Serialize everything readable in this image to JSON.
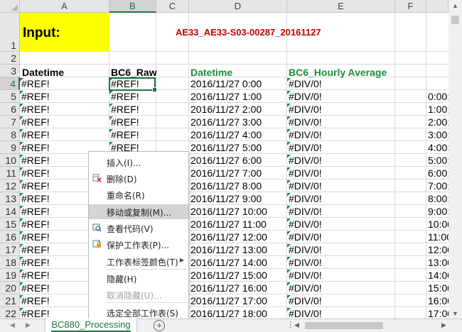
{
  "columns": [
    "A",
    "B",
    "C",
    "D",
    "E",
    "F"
  ],
  "rows": [
    "1",
    "2",
    "3",
    "4",
    "5",
    "6",
    "7",
    "8",
    "9",
    "10",
    "11",
    "12",
    "13",
    "14",
    "15",
    "16",
    "17",
    "18",
    "19",
    "20",
    "21",
    "22"
  ],
  "top": {
    "input_label": "Input:",
    "file_name": "AE33_AE33-S03-00287_20161127"
  },
  "headers": {
    "a": "Datetime",
    "b": "BC6_Raw",
    "d": "Datetime",
    "e": "BC6_Hourly Average"
  },
  "ref_error": "#REF!",
  "div_error": "#DIV/0!",
  "datetimes": [
    "2016/11/27 0:00",
    "2016/11/27 1:00",
    "2016/11/27 2:00",
    "2016/11/27 3:00",
    "2016/11/27 4:00",
    "2016/11/27 5:00",
    "2016/11/27 6:00",
    "2016/11/27 7:00",
    "2016/11/27 8:00",
    "2016/11/27 9:00",
    "2016/11/27 10:00",
    "2016/11/27 11:00",
    "2016/11/27 12:00",
    "2016/11/27 13:00",
    "2016/11/27 14:00",
    "2016/11/27 15:00",
    "2016/11/27 16:00",
    "2016/11/27 17:00",
    "2016/11/27 18:00"
  ],
  "g_times": [
    "",
    "0:00",
    "1:00",
    "2:00",
    "3:00",
    "4:00",
    "5:00",
    "6:00",
    "7:00",
    "8:00",
    "9:00",
    "10:00",
    "11:00",
    "12:00",
    "13:00",
    "14:00",
    "15:00",
    "16:00",
    "17:00"
  ],
  "g_times_partial": [
    "",
    "0:00:",
    "1:00:",
    "2:00:",
    "3:00:",
    "4:00:",
    "5:00:",
    "6:00:",
    "7:00:",
    "8:00:",
    "9:00:",
    "10:00",
    "11:00",
    "12:00",
    "13:00",
    "14:00",
    "15:00",
    "16:00",
    "17:00"
  ],
  "context_menu": [
    {
      "label": "插入(I)...",
      "icon": "",
      "disabled": false
    },
    {
      "label": "删除(D)",
      "icon": "delete-sheet-icon",
      "disabled": false
    },
    {
      "label": "重命名(R)",
      "icon": "",
      "disabled": false
    },
    {
      "label": "移动或复制(M)...",
      "icon": "",
      "disabled": false,
      "highlighted": true
    },
    {
      "label": "查看代码(V)",
      "icon": "view-code-icon",
      "disabled": false
    },
    {
      "label": "保护工作表(P)...",
      "icon": "protect-sheet-icon",
      "disabled": false
    },
    {
      "label": "工作表标签颜色(T)",
      "icon": "",
      "disabled": false,
      "submenu": true
    },
    {
      "label": "隐藏(H)",
      "icon": "",
      "disabled": false
    },
    {
      "label": "取消隐藏(U)...",
      "icon": "",
      "disabled": true
    },
    {
      "label": "选定全部工作表(S)",
      "icon": "",
      "disabled": false
    }
  ],
  "sheet_tab": "BC880_Processing",
  "colors": {
    "accent": "#217346",
    "input_fill": "#ffff00",
    "file_red": "#c00000",
    "header_green": "#1e8a3e"
  }
}
